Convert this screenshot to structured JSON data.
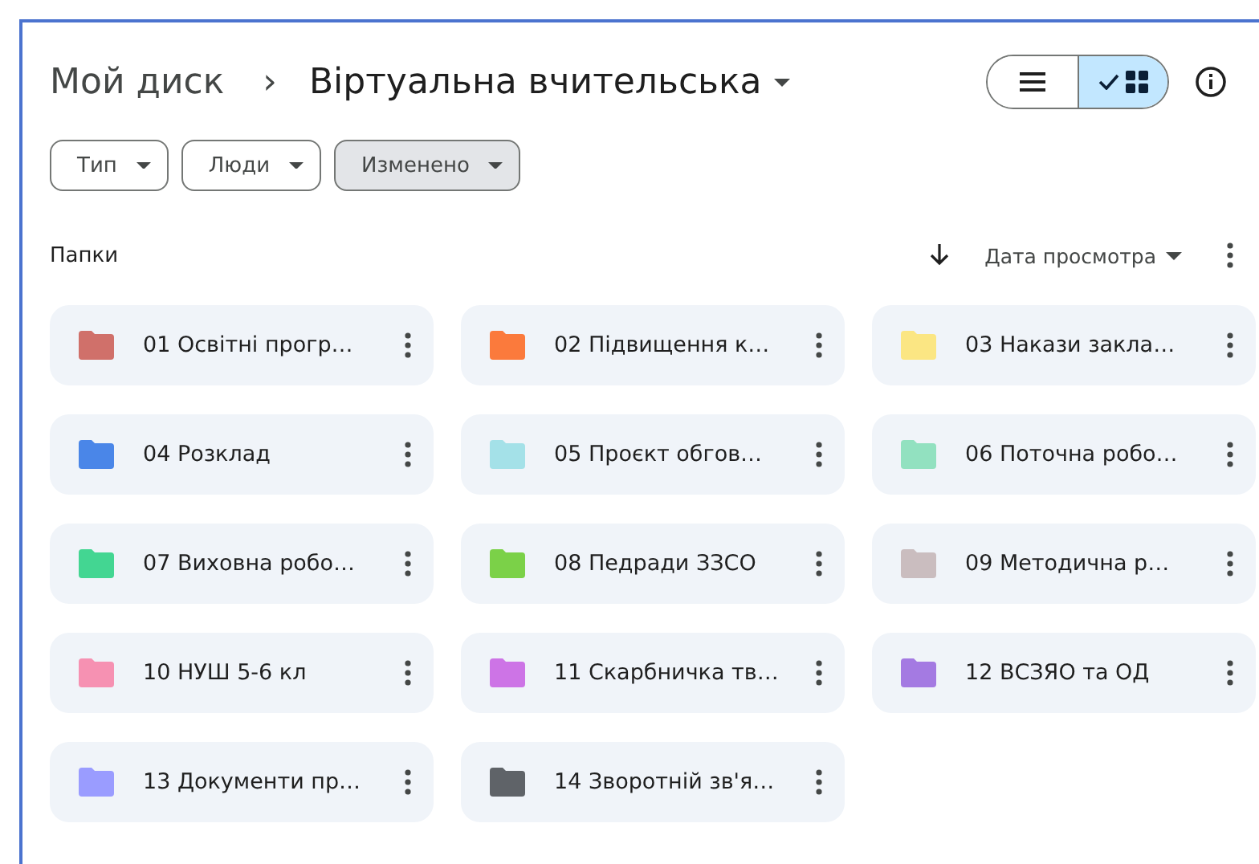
{
  "breadcrumb": {
    "root": "Мой диск",
    "separator": "›",
    "current": "Віртуальна вчительська"
  },
  "view_toggle": [
    {
      "kind": "list",
      "selected": false
    },
    {
      "kind": "grid",
      "selected": true
    }
  ],
  "filters": [
    {
      "label": "Тип",
      "active": false
    },
    {
      "label": "Люди",
      "active": false
    },
    {
      "label": "Изменено",
      "active": true
    }
  ],
  "section": {
    "title": "Папки",
    "sort_label": "Дата просмотра"
  },
  "folders": [
    {
      "name": "01 Освітні прогр…",
      "color": "#d0706a"
    },
    {
      "name": "02 Підвищення к…",
      "color": "#fb7a3c"
    },
    {
      "name": "03 Накази закла…",
      "color": "#fbe683"
    },
    {
      "name": "04 Розклад",
      "color": "#4a86e8"
    },
    {
      "name": "05 Проєкт обгов…",
      "color": "#a4e1e8"
    },
    {
      "name": "06 Поточна робо…",
      "color": "#92e1c0"
    },
    {
      "name": "07 Виховна робо…",
      "color": "#43d692"
    },
    {
      "name": "08 Педради ЗЗСО",
      "color": "#7bd148"
    },
    {
      "name": "09 Методична р…",
      "color": "#cabdbf"
    },
    {
      "name": "10 НУШ 5-6 кл",
      "color": "#f691b2"
    },
    {
      "name": "11 Скарбничка тв…",
      "color": "#cd74e6"
    },
    {
      "name": "12 ВСЗЯО та ОД",
      "color": "#a47ae2"
    },
    {
      "name": "13 Документи пр…",
      "color": "#9a9cff"
    },
    {
      "name": "14 Зворотній зв'я…",
      "color": "#5f6368"
    }
  ]
}
